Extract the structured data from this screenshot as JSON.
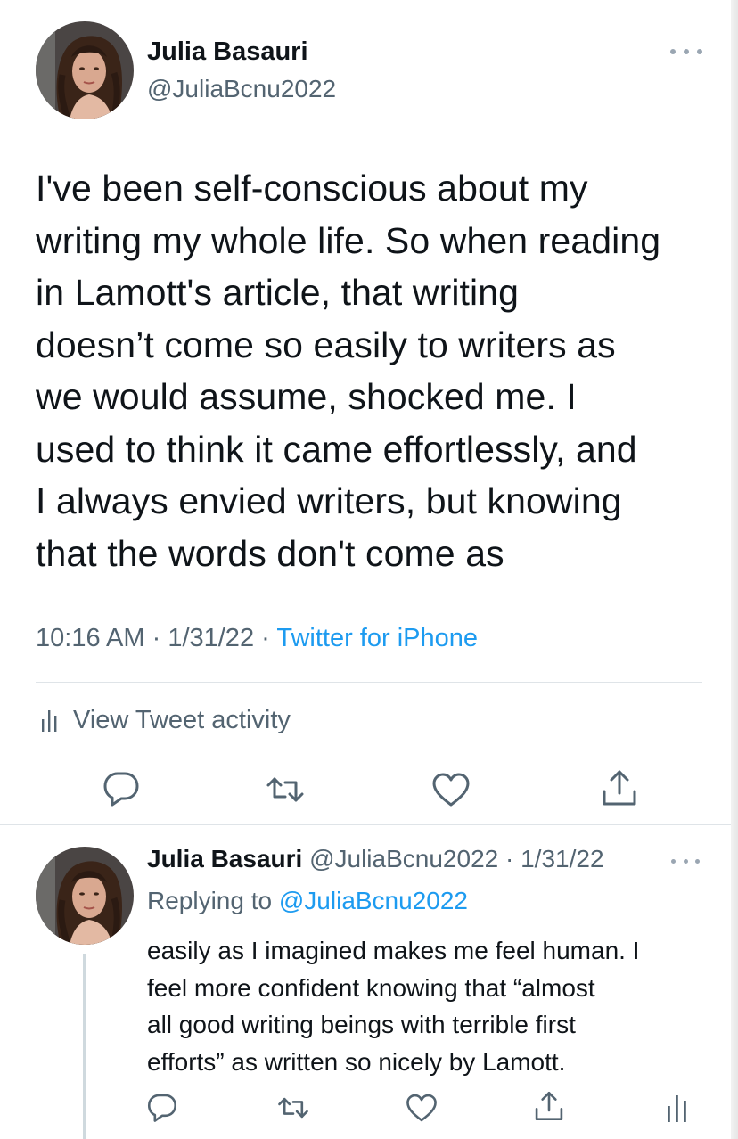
{
  "main_tweet": {
    "author_name": "Julia Basauri",
    "author_handle": "@JuliaBcnu2022",
    "text_lines": [
      "I've been self-conscious about my",
      "writing my whole life. So when reading",
      "in Lamott's article, that writing",
      "doesn’t come so easily to writers as",
      "we would assume, shocked me. I",
      "used to think it came effortlessly, and",
      "I always envied writers, but knowing",
      "that the words don't come as"
    ],
    "time": "10:16 AM",
    "date": "1/31/22",
    "source": "Twitter for iPhone",
    "activity_label": "View Tweet activity",
    "icons": [
      "more-icon",
      "activity-icon",
      "reply-icon",
      "retweet-icon",
      "like-icon",
      "share-icon"
    ]
  },
  "reply_tweet": {
    "author_name": "Julia Basauri",
    "author_handle": "@JuliaBcnu2022",
    "date": "1/31/22",
    "replying_prefix": "Replying to",
    "replying_to": "@JuliaBcnu2022",
    "text_lines": [
      "easily as I imagined makes me feel human. I",
      "feel more confident knowing that “almost",
      "all good writing beings with terrible first",
      "efforts” as written so nicely by Lamott."
    ],
    "icons": [
      "reply-icon",
      "retweet-icon",
      "like-icon",
      "share-icon",
      "analytics-icon"
    ]
  },
  "colors": {
    "text": "#0f1419",
    "secondary": "#536471",
    "accent": "#1d9bf0",
    "divider": "#dfe4e8"
  }
}
